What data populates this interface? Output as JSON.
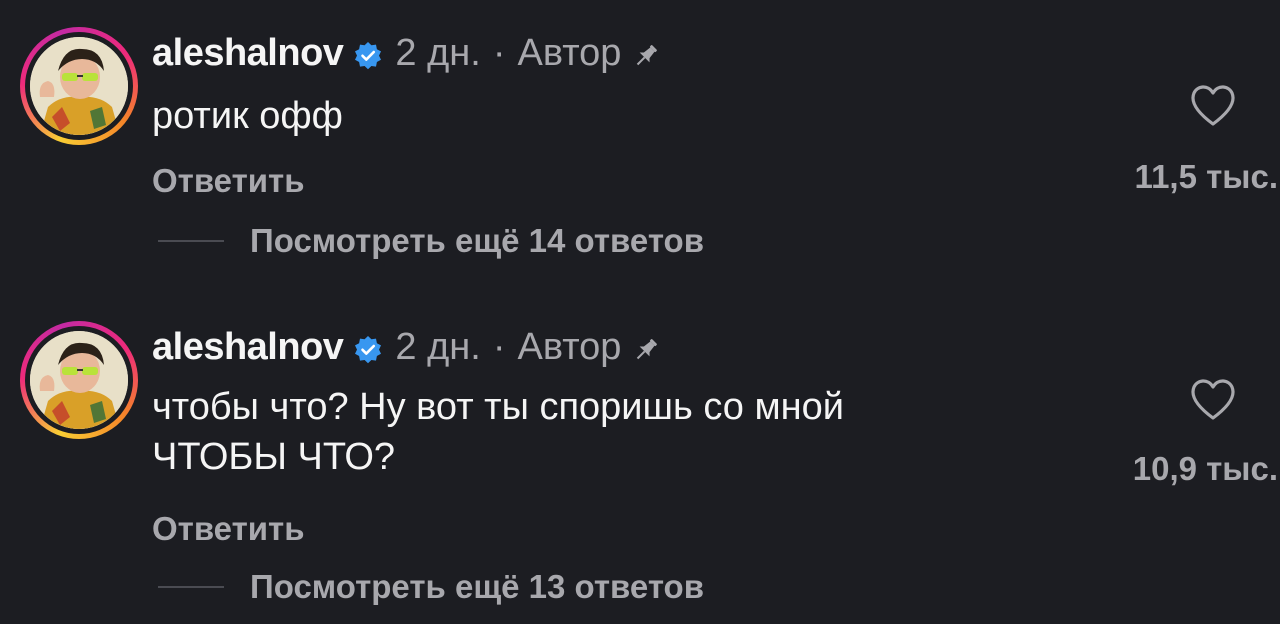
{
  "comments": [
    {
      "username": "aleshalnov",
      "time": "2 дн.",
      "separator": "·",
      "author_label": "Автор",
      "text_lines": [
        "ротик офф"
      ],
      "reply_label": "Ответить",
      "view_replies_label": "Посмотреть ещё 14 ответов",
      "like_count": "11,5 тыс."
    },
    {
      "username": "aleshalnov",
      "time": "2 дн.",
      "separator": "·",
      "author_label": "Автор",
      "text_lines": [
        "чтобы что? Ну вот ты споришь со мной",
        "ЧТОБЫ ЧТО?"
      ],
      "reply_label": "Ответить",
      "view_replies_label": "Посмотреть ещё 13 ответов",
      "like_count": "10,9 тыс."
    }
  ],
  "icons": {
    "verified": "verified-badge-icon",
    "pin": "pin-icon",
    "like": "heart-icon"
  },
  "colors": {
    "background": "#1c1d22",
    "primary_text": "#f5f5f5",
    "secondary_text": "#a8a8ad",
    "verified_blue": "#3897f0"
  }
}
